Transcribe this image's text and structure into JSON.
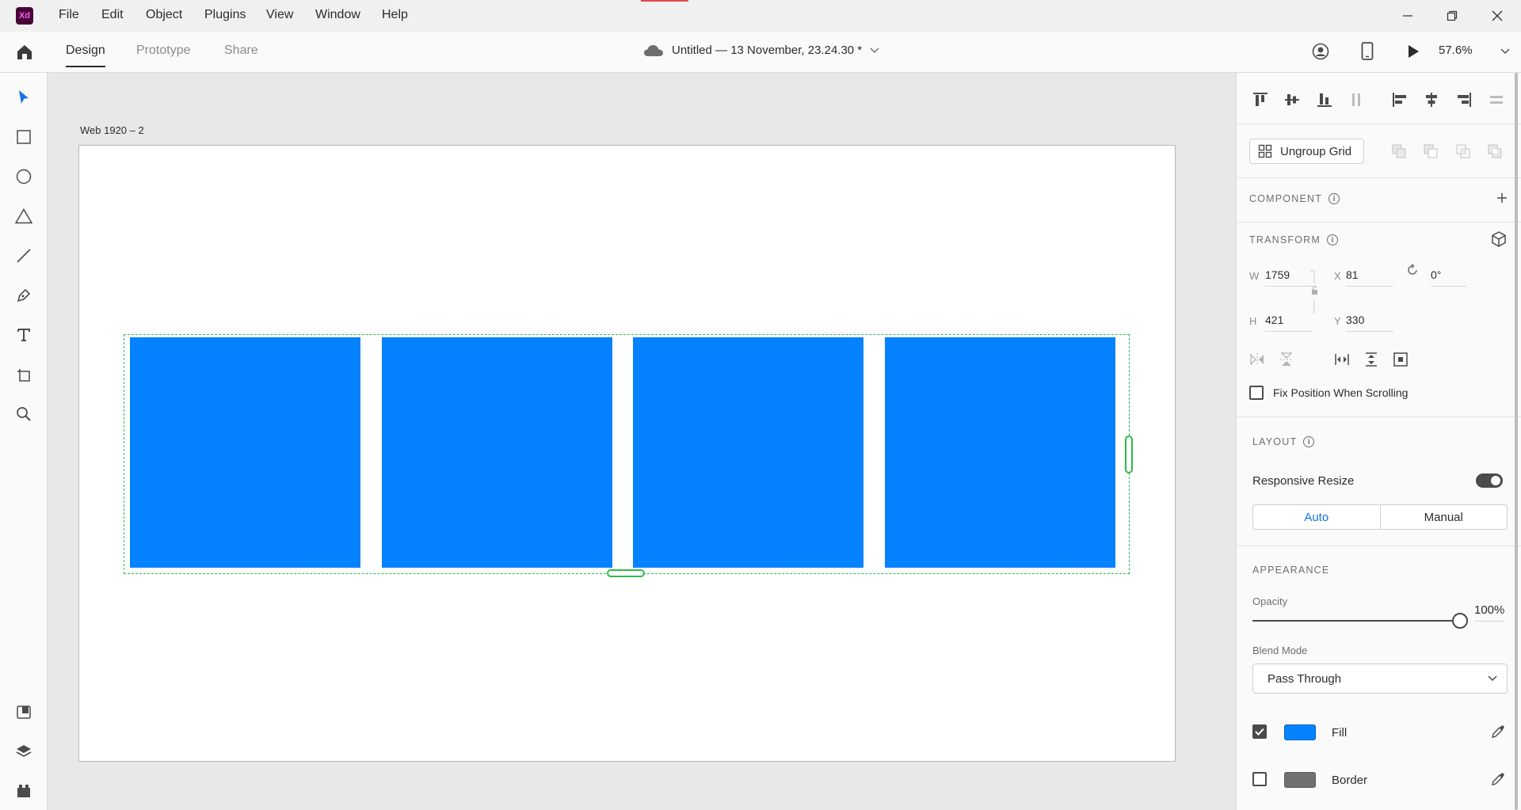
{
  "app": {
    "logo_text": "Xd"
  },
  "menu": {
    "items": [
      "File",
      "Edit",
      "Object",
      "Plugins",
      "View",
      "Window",
      "Help"
    ]
  },
  "tabs": [
    "Design",
    "Prototype",
    "Share"
  ],
  "document": {
    "title": "Untitled — 13 November, 23.24.30 *"
  },
  "zoom": "57.6%",
  "artboard": {
    "label": "Web 1920 – 2",
    "background": "#ffffff"
  },
  "grid": {
    "cell_color": "#0582ff",
    "cell_count": 4,
    "selection_color": "#2dbb4a"
  },
  "panel": {
    "ungroup_label": "Ungroup Grid",
    "component_title": "COMPONENT",
    "transform_title": "TRANSFORM",
    "w_label": "W",
    "w_value": "1759",
    "x_label": "X",
    "x_value": "81",
    "h_label": "H",
    "h_value": "421",
    "y_label": "Y",
    "y_value": "330",
    "rotation_value": "0°",
    "fix_position_label": "Fix Position When Scrolling",
    "fix_position_checked": false,
    "layout_title": "LAYOUT",
    "responsive_resize_label": "Responsive Resize",
    "responsive_resize_on": true,
    "auto_label": "Auto",
    "manual_label": "Manual",
    "appearance_title": "APPEARANCE",
    "opacity_label": "Opacity",
    "opacity_value": "100%",
    "opacity_level": 1.0,
    "blend_mode_label": "Blend Mode",
    "blend_mode_value": "Pass Through",
    "fill_label": "Fill",
    "fill_checked": true,
    "fill_color": "#0582ff",
    "border_label": "Border",
    "border_checked": false,
    "border_color": "#707070"
  }
}
